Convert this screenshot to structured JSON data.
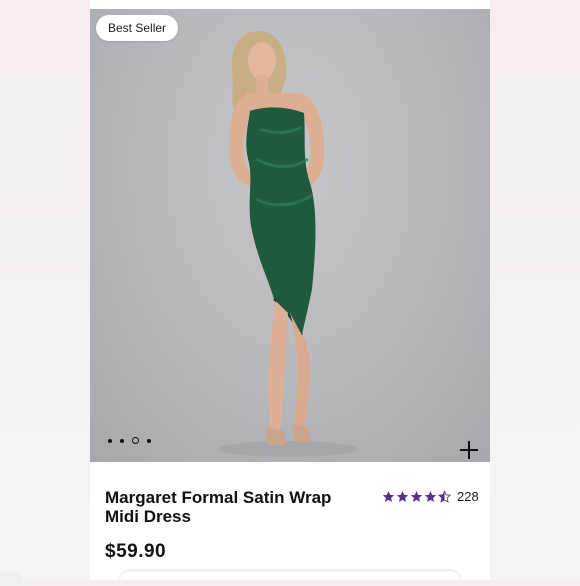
{
  "product": {
    "badge": "Best Seller",
    "title": "Margaret Formal Satin Wrap Midi Dress",
    "price": "$59.90",
    "rating_value": 4.5,
    "rating_count": "228",
    "star_color": "#5b2d8e"
  },
  "gallery": {
    "image_count": 4,
    "active_index": 2,
    "image_description_icon": "green-satin-dress-photo",
    "add_icon": "plus-icon"
  }
}
